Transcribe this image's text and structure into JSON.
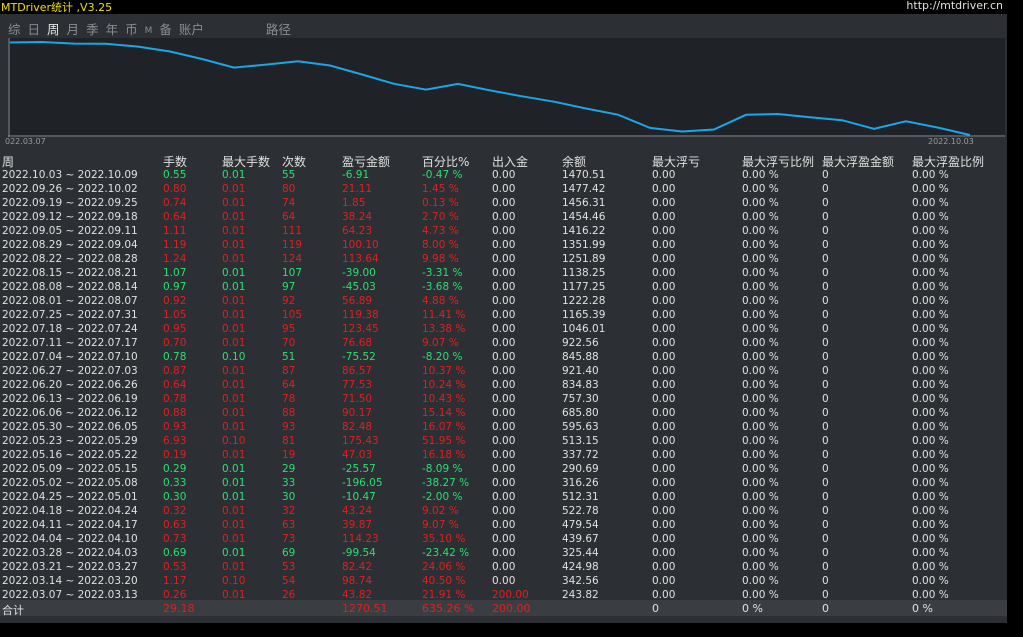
{
  "header": {
    "title": "MTDriver统计 ,V3.25",
    "url": "http://mtdriver.cn"
  },
  "tabs": [
    {
      "label": "综",
      "active": false,
      "small": false
    },
    {
      "label": "日",
      "active": false,
      "small": false
    },
    {
      "label": "周",
      "active": true,
      "small": false
    },
    {
      "label": "月",
      "active": false,
      "small": false
    },
    {
      "label": "季",
      "active": false,
      "small": false
    },
    {
      "label": "年",
      "active": false,
      "small": false
    },
    {
      "label": "币",
      "active": false,
      "small": false
    },
    {
      "label": "M",
      "active": false,
      "small": true
    },
    {
      "label": "备",
      "active": false,
      "small": false
    },
    {
      "label": "账户",
      "active": false,
      "small": false
    },
    {
      "label": "路径",
      "active": false,
      "small": false
    }
  ],
  "chart_data": {
    "type": "line",
    "series": [
      {
        "values": [
          243.82,
          342.56,
          424.98,
          325.44,
          439.67,
          479.54,
          522.78,
          512.31,
          316.26,
          290.69,
          337.72,
          513.15,
          595.63,
          685.8,
          757.3,
          834.83,
          921.4,
          845.88,
          922.56,
          1046.01,
          1165.39,
          1222.28,
          1177.25,
          1138.25,
          1251.89,
          1351.99,
          1416.22,
          1454.46,
          1456.31,
          1477.42,
          1470.51
        ]
      }
    ],
    "x_start_label": "022.03.07",
    "x_end_label": "2022.10.03",
    "color": "#1aa7e8"
  },
  "table": {
    "columns": [
      "周",
      "手数",
      "最大手数",
      "次数",
      "盈亏金额",
      "百分比%",
      "出入金",
      "余额",
      "最大浮亏",
      "最大浮亏比例",
      "最大浮盈金额",
      "最大浮盈比例"
    ],
    "rows": [
      {
        "week": "2022.10.03 ~ 2022.10.09",
        "lots": "0.55",
        "maxlots": "0.01",
        "count": "55",
        "pnl": "-6.91",
        "pct": "-0.47 %",
        "flow": "0.00",
        "bal": "1470.51",
        "mdd": "0.00",
        "mddp": "0.00 %",
        "mfe": "0",
        "mfep": "0.00 %",
        "pos": false
      },
      {
        "week": "2022.09.26 ~ 2022.10.02",
        "lots": "0.80",
        "maxlots": "0.01",
        "count": "80",
        "pnl": "21.11",
        "pct": "1.45 %",
        "flow": "0.00",
        "bal": "1477.42",
        "mdd": "0.00",
        "mddp": "0.00 %",
        "mfe": "0",
        "mfep": "0.00 %",
        "pos": true
      },
      {
        "week": "2022.09.19 ~ 2022.09.25",
        "lots": "0.74",
        "maxlots": "0.01",
        "count": "74",
        "pnl": "1.85",
        "pct": "0.13 %",
        "flow": "0.00",
        "bal": "1456.31",
        "mdd": "0.00",
        "mddp": "0.00 %",
        "mfe": "0",
        "mfep": "0.00 %",
        "pos": true
      },
      {
        "week": "2022.09.12 ~ 2022.09.18",
        "lots": "0.64",
        "maxlots": "0.01",
        "count": "64",
        "pnl": "38.24",
        "pct": "2.70 %",
        "flow": "0.00",
        "bal": "1454.46",
        "mdd": "0.00",
        "mddp": "0.00 %",
        "mfe": "0",
        "mfep": "0.00 %",
        "pos": true
      },
      {
        "week": "2022.09.05 ~ 2022.09.11",
        "lots": "1.11",
        "maxlots": "0.01",
        "count": "111",
        "pnl": "64.23",
        "pct": "4.73 %",
        "flow": "0.00",
        "bal": "1416.22",
        "mdd": "0.00",
        "mddp": "0.00 %",
        "mfe": "0",
        "mfep": "0.00 %",
        "pos": true
      },
      {
        "week": "2022.08.29 ~ 2022.09.04",
        "lots": "1.19",
        "maxlots": "0.01",
        "count": "119",
        "pnl": "100.10",
        "pct": "8.00 %",
        "flow": "0.00",
        "bal": "1351.99",
        "mdd": "0.00",
        "mddp": "0.00 %",
        "mfe": "0",
        "mfep": "0.00 %",
        "pos": true
      },
      {
        "week": "2022.08.22 ~ 2022.08.28",
        "lots": "1.24",
        "maxlots": "0.01",
        "count": "124",
        "pnl": "113.64",
        "pct": "9.98 %",
        "flow": "0.00",
        "bal": "1251.89",
        "mdd": "0.00",
        "mddp": "0.00 %",
        "mfe": "0",
        "mfep": "0.00 %",
        "pos": true
      },
      {
        "week": "2022.08.15 ~ 2022.08.21",
        "lots": "1.07",
        "maxlots": "0.01",
        "count": "107",
        "pnl": "-39.00",
        "pct": "-3.31 %",
        "flow": "0.00",
        "bal": "1138.25",
        "mdd": "0.00",
        "mddp": "0.00 %",
        "mfe": "0",
        "mfep": "0.00 %",
        "pos": false
      },
      {
        "week": "2022.08.08 ~ 2022.08.14",
        "lots": "0.97",
        "maxlots": "0.01",
        "count": "97",
        "pnl": "-45.03",
        "pct": "-3.68 %",
        "flow": "0.00",
        "bal": "1177.25",
        "mdd": "0.00",
        "mddp": "0.00 %",
        "mfe": "0",
        "mfep": "0.00 %",
        "pos": false
      },
      {
        "week": "2022.08.01 ~ 2022.08.07",
        "lots": "0.92",
        "maxlots": "0.01",
        "count": "92",
        "pnl": "56.89",
        "pct": "4.88 %",
        "flow": "0.00",
        "bal": "1222.28",
        "mdd": "0.00",
        "mddp": "0.00 %",
        "mfe": "0",
        "mfep": "0.00 %",
        "pos": true
      },
      {
        "week": "2022.07.25 ~ 2022.07.31",
        "lots": "1.05",
        "maxlots": "0.01",
        "count": "105",
        "pnl": "119.38",
        "pct": "11.41 %",
        "flow": "0.00",
        "bal": "1165.39",
        "mdd": "0.00",
        "mddp": "0.00 %",
        "mfe": "0",
        "mfep": "0.00 %",
        "pos": true
      },
      {
        "week": "2022.07.18 ~ 2022.07.24",
        "lots": "0.95",
        "maxlots": "0.01",
        "count": "95",
        "pnl": "123.45",
        "pct": "13.38 %",
        "flow": "0.00",
        "bal": "1046.01",
        "mdd": "0.00",
        "mddp": "0.00 %",
        "mfe": "0",
        "mfep": "0.00 %",
        "pos": true
      },
      {
        "week": "2022.07.11 ~ 2022.07.17",
        "lots": "0.70",
        "maxlots": "0.01",
        "count": "70",
        "pnl": "76.68",
        "pct": "9.07 %",
        "flow": "0.00",
        "bal": "922.56",
        "mdd": "0.00",
        "mddp": "0.00 %",
        "mfe": "0",
        "mfep": "0.00 %",
        "pos": true
      },
      {
        "week": "2022.07.04 ~ 2022.07.10",
        "lots": "0.78",
        "maxlots": "0.10",
        "count": "51",
        "pnl": "-75.52",
        "pct": "-8.20 %",
        "flow": "0.00",
        "bal": "845.88",
        "mdd": "0.00",
        "mddp": "0.00 %",
        "mfe": "0",
        "mfep": "0.00 %",
        "pos": false
      },
      {
        "week": "2022.06.27 ~ 2022.07.03",
        "lots": "0.87",
        "maxlots": "0.01",
        "count": "87",
        "pnl": "86.57",
        "pct": "10.37 %",
        "flow": "0.00",
        "bal": "921.40",
        "mdd": "0.00",
        "mddp": "0.00 %",
        "mfe": "0",
        "mfep": "0.00 %",
        "pos": true
      },
      {
        "week": "2022.06.20 ~ 2022.06.26",
        "lots": "0.64",
        "maxlots": "0.01",
        "count": "64",
        "pnl": "77.53",
        "pct": "10.24 %",
        "flow": "0.00",
        "bal": "834.83",
        "mdd": "0.00",
        "mddp": "0.00 %",
        "mfe": "0",
        "mfep": "0.00 %",
        "pos": true
      },
      {
        "week": "2022.06.13 ~ 2022.06.19",
        "lots": "0.78",
        "maxlots": "0.01",
        "count": "78",
        "pnl": "71.50",
        "pct": "10.43 %",
        "flow": "0.00",
        "bal": "757.30",
        "mdd": "0.00",
        "mddp": "0.00 %",
        "mfe": "0",
        "mfep": "0.00 %",
        "pos": true
      },
      {
        "week": "2022.06.06 ~ 2022.06.12",
        "lots": "0.88",
        "maxlots": "0.01",
        "count": "88",
        "pnl": "90.17",
        "pct": "15.14 %",
        "flow": "0.00",
        "bal": "685.80",
        "mdd": "0.00",
        "mddp": "0.00 %",
        "mfe": "0",
        "mfep": "0.00 %",
        "pos": true
      },
      {
        "week": "2022.05.30 ~ 2022.06.05",
        "lots": "0.93",
        "maxlots": "0.01",
        "count": "93",
        "pnl": "82.48",
        "pct": "16.07 %",
        "flow": "0.00",
        "bal": "595.63",
        "mdd": "0.00",
        "mddp": "0.00 %",
        "mfe": "0",
        "mfep": "0.00 %",
        "pos": true
      },
      {
        "week": "2022.05.23 ~ 2022.05.29",
        "lots": "6.93",
        "maxlots": "0.10",
        "count": "81",
        "pnl": "175.43",
        "pct": "51.95 %",
        "flow": "0.00",
        "bal": "513.15",
        "mdd": "0.00",
        "mddp": "0.00 %",
        "mfe": "0",
        "mfep": "0.00 %",
        "pos": true
      },
      {
        "week": "2022.05.16 ~ 2022.05.22",
        "lots": "0.19",
        "maxlots": "0.01",
        "count": "19",
        "pnl": "47.03",
        "pct": "16.18 %",
        "flow": "0.00",
        "bal": "337.72",
        "mdd": "0.00",
        "mddp": "0.00 %",
        "mfe": "0",
        "mfep": "0.00 %",
        "pos": true
      },
      {
        "week": "2022.05.09 ~ 2022.05.15",
        "lots": "0.29",
        "maxlots": "0.01",
        "count": "29",
        "pnl": "-25.57",
        "pct": "-8.09 %",
        "flow": "0.00",
        "bal": "290.69",
        "mdd": "0.00",
        "mddp": "0.00 %",
        "mfe": "0",
        "mfep": "0.00 %",
        "pos": false
      },
      {
        "week": "2022.05.02 ~ 2022.05.08",
        "lots": "0.33",
        "maxlots": "0.01",
        "count": "33",
        "pnl": "-196.05",
        "pct": "-38.27 %",
        "flow": "0.00",
        "bal": "316.26",
        "mdd": "0.00",
        "mddp": "0.00 %",
        "mfe": "0",
        "mfep": "0.00 %",
        "pos": false
      },
      {
        "week": "2022.04.25 ~ 2022.05.01",
        "lots": "0.30",
        "maxlots": "0.01",
        "count": "30",
        "pnl": "-10.47",
        "pct": "-2.00 %",
        "flow": "0.00",
        "bal": "512.31",
        "mdd": "0.00",
        "mddp": "0.00 %",
        "mfe": "0",
        "mfep": "0.00 %",
        "pos": false
      },
      {
        "week": "2022.04.18 ~ 2022.04.24",
        "lots": "0.32",
        "maxlots": "0.01",
        "count": "32",
        "pnl": "43.24",
        "pct": "9.02 %",
        "flow": "0.00",
        "bal": "522.78",
        "mdd": "0.00",
        "mddp": "0.00 %",
        "mfe": "0",
        "mfep": "0.00 %",
        "pos": true
      },
      {
        "week": "2022.04.11 ~ 2022.04.17",
        "lots": "0.63",
        "maxlots": "0.01",
        "count": "63",
        "pnl": "39.87",
        "pct": "9.07 %",
        "flow": "0.00",
        "bal": "479.54",
        "mdd": "0.00",
        "mddp": "0.00 %",
        "mfe": "0",
        "mfep": "0.00 %",
        "pos": true
      },
      {
        "week": "2022.04.04 ~ 2022.04.10",
        "lots": "0.73",
        "maxlots": "0.01",
        "count": "73",
        "pnl": "114.23",
        "pct": "35.10 %",
        "flow": "0.00",
        "bal": "439.67",
        "mdd": "0.00",
        "mddp": "0.00 %",
        "mfe": "0",
        "mfep": "0.00 %",
        "pos": true
      },
      {
        "week": "2022.03.28 ~ 2022.04.03",
        "lots": "0.69",
        "maxlots": "0.01",
        "count": "69",
        "pnl": "-99.54",
        "pct": "-23.42 %",
        "flow": "0.00",
        "bal": "325.44",
        "mdd": "0.00",
        "mddp": "0.00 %",
        "mfe": "0",
        "mfep": "0.00 %",
        "pos": false
      },
      {
        "week": "2022.03.21 ~ 2022.03.27",
        "lots": "0.53",
        "maxlots": "0.01",
        "count": "53",
        "pnl": "82.42",
        "pct": "24.06 %",
        "flow": "0.00",
        "bal": "424.98",
        "mdd": "0.00",
        "mddp": "0.00 %",
        "mfe": "0",
        "mfep": "0.00 %",
        "pos": true
      },
      {
        "week": "2022.03.14 ~ 2022.03.20",
        "lots": "1.17",
        "maxlots": "0.10",
        "count": "54",
        "pnl": "98.74",
        "pct": "40.50 %",
        "flow": "0.00",
        "bal": "342.56",
        "mdd": "0.00",
        "mddp": "0.00 %",
        "mfe": "0",
        "mfep": "0.00 %",
        "pos": true
      },
      {
        "week": "2022.03.07 ~ 2022.03.13",
        "lots": "0.26",
        "maxlots": "0.01",
        "count": "26",
        "pnl": "43.82",
        "pct": "21.91 %",
        "flow": "200.00",
        "bal": "243.82",
        "mdd": "0.00",
        "mddp": "0.00 %",
        "mfe": "0",
        "mfep": "0.00 %",
        "pos": true
      }
    ],
    "total": {
      "label": "合计",
      "lots": "29.18",
      "pnl": "1270.51",
      "pct": "635.26 %",
      "flow": "200.00",
      "mdd": "0",
      "mddp": "0 %",
      "mfe": "0",
      "mfep": "0 %"
    }
  },
  "colors": {
    "positive": "#e02020",
    "negative": "#28e070",
    "title": "#f0e000",
    "line": "#1aa7e8"
  }
}
